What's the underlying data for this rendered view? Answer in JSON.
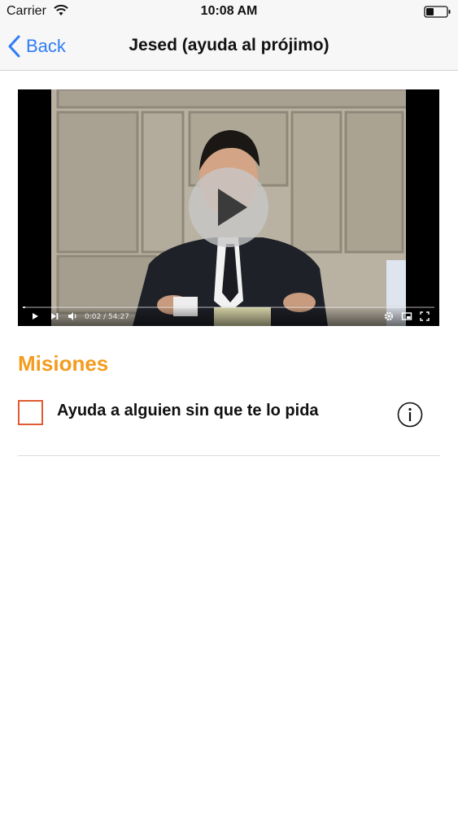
{
  "status_bar": {
    "carrier": "Carrier",
    "time": "10:08 AM",
    "icons": [
      "wifi-icon",
      "battery-icon"
    ]
  },
  "nav": {
    "back_label": "Back",
    "title": "Jesed (ayuda al prójimo)",
    "accent_color": "#2f7cf6"
  },
  "video": {
    "time_display": "0:02 / 54:27",
    "progress_fraction": 0.0006,
    "icons": [
      "play-icon",
      "skip-icon",
      "volume-icon",
      "settings-icon",
      "miniplayer-icon",
      "fullscreen-icon"
    ]
  },
  "missions": {
    "title": "Misiones",
    "title_color": "#f39c1e",
    "items": [
      {
        "label": "Ayuda a alguien sin que te lo pida",
        "checked": false
      }
    ]
  }
}
